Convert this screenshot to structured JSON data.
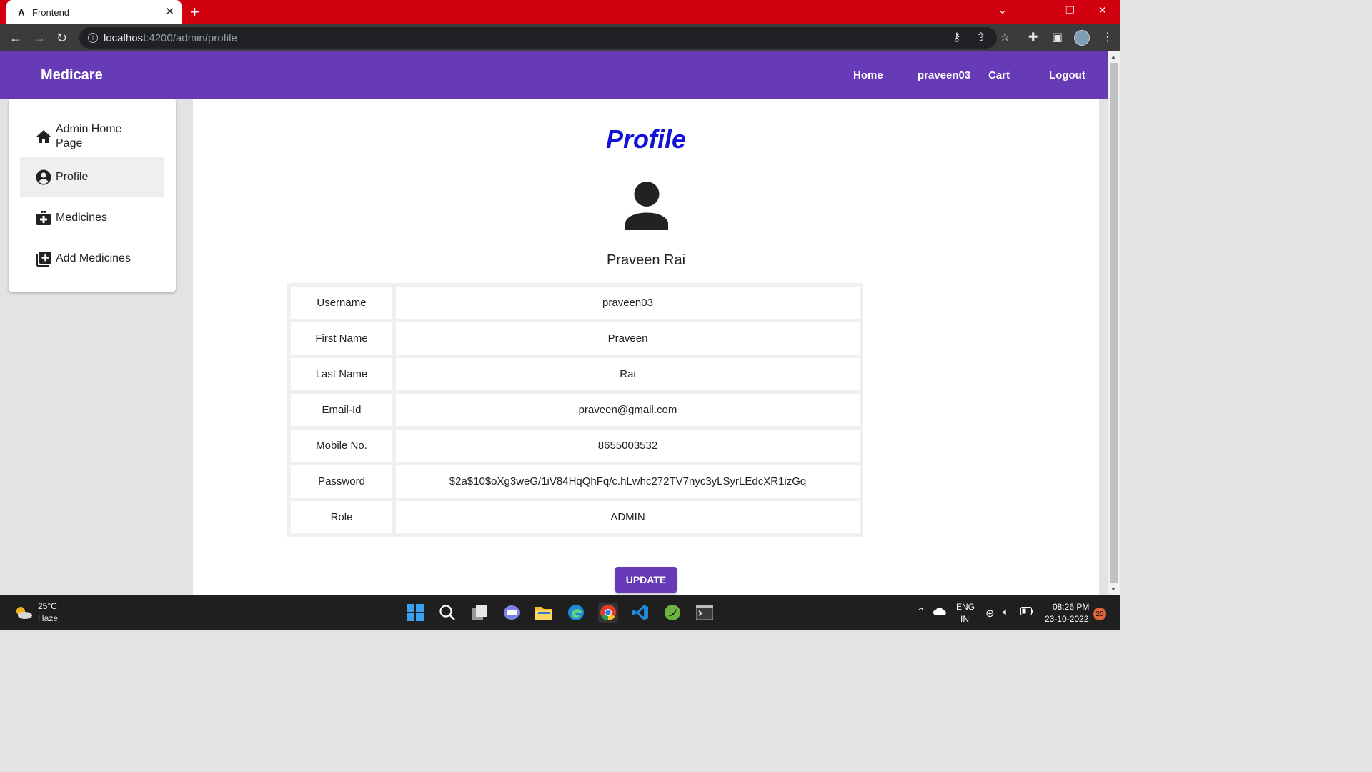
{
  "browser": {
    "tab_title": "Frontend",
    "tab_favicon": "A",
    "url_host": "localhost",
    "url_path": ":4200/admin/profile",
    "tab_close": "✕",
    "new_tab": "+"
  },
  "header": {
    "brand": "Medicare",
    "nav": [
      "Home",
      "praveen03",
      "Cart",
      "Logout"
    ]
  },
  "sidebar": {
    "items": [
      {
        "label": "Admin Home Page",
        "icon": "home-icon"
      },
      {
        "label": "Profile",
        "icon": "account-circle-icon",
        "active": true
      },
      {
        "label": "Medicines",
        "icon": "medical-bag-icon"
      },
      {
        "label": "Add Medicines",
        "icon": "library-add-icon"
      }
    ]
  },
  "profile": {
    "title": "Profile",
    "full_name": "Praveen Rai",
    "rows": [
      {
        "label": "Username",
        "value": "praveen03"
      },
      {
        "label": "First Name",
        "value": "Praveen"
      },
      {
        "label": "Last Name",
        "value": "Rai"
      },
      {
        "label": "Email-Id",
        "value": "praveen@gmail.com"
      },
      {
        "label": "Mobile No.",
        "value": "8655003532"
      },
      {
        "label": "Password",
        "value": "$2a$10$oXg3weG/1iV84HqQhFq/c.hLwhc272TV7nyc3yLSyrLEdcXR1izGq"
      },
      {
        "label": "Role",
        "value": "ADMIN"
      }
    ],
    "update_label": "UPDATE"
  },
  "taskbar": {
    "weather_temp": "25°C",
    "weather_desc": "Haze",
    "lang_top": "ENG",
    "lang_bottom": "IN",
    "time": "08:26 PM",
    "date": "23-10-2022",
    "notification_count": "20"
  },
  "colors": {
    "brand": "#673ab7",
    "title": "#1010d8",
    "tabbar": "#d1000f"
  }
}
